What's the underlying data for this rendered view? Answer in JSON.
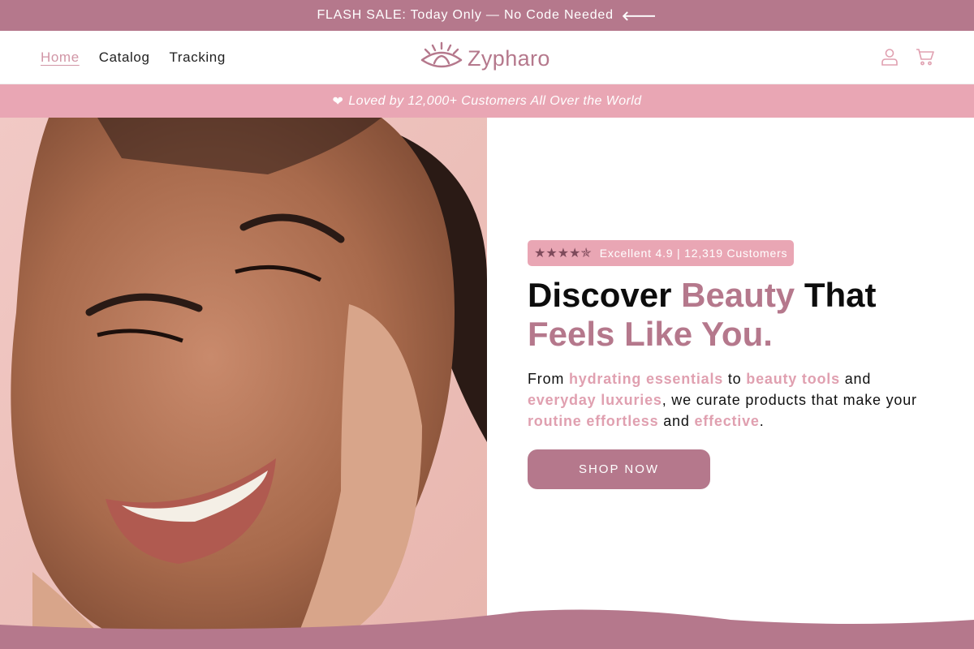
{
  "announcement": {
    "text": "FLASH SALE: Today Only — No Code Needed",
    "arrow": "🡐"
  },
  "nav": [
    {
      "label": "Home",
      "active": true
    },
    {
      "label": "Catalog",
      "active": false
    },
    {
      "label": "Tracking",
      "active": false
    }
  ],
  "brand": {
    "name": "Zypharo"
  },
  "header_icons": [
    "account-icon",
    "cart-icon"
  ],
  "social_proof": {
    "heart": "❤",
    "text": "Loved by 12,000+ Customers All Over the World"
  },
  "hero": {
    "rating": {
      "stars": "★★★★✯",
      "text": "Excellent 4.9 | 12,319 Customers"
    },
    "headline": {
      "part1": "Discover ",
      "accent1": "Beauty",
      "part2": " That",
      "accent2": "Feels Like You."
    },
    "description": {
      "t1": "From ",
      "h1": "hydrating essentials",
      "t2": " to ",
      "h2": "beauty tools",
      "t3": " and ",
      "h3": "everyday luxuries",
      "t4": ", we curate products that make your ",
      "h4": "routine effortless",
      "t5": " and ",
      "h5": "effective",
      "t6": "."
    },
    "cta": "SHOP NOW"
  },
  "colors": {
    "brand_mauve": "#b5788c",
    "pink_bar": "#e9a6b4",
    "highlight_pink": "#e0a0b0"
  }
}
